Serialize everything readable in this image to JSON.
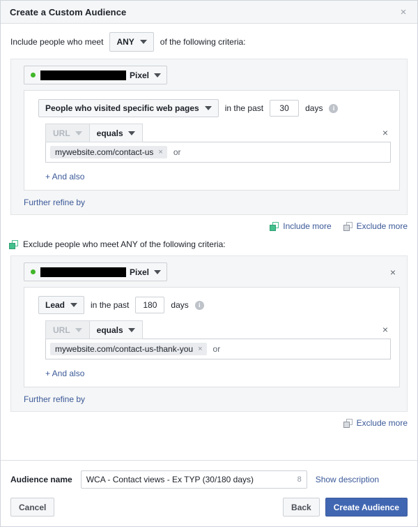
{
  "dialog": {
    "title": "Create a Custom Audience",
    "close_icon": "×"
  },
  "include": {
    "prefix_text": "Include people who meet",
    "match_operator": "ANY",
    "suffix_text": "of the following criteria:",
    "pixel": {
      "name_redacted": "",
      "label": "Pixel",
      "status": "active"
    },
    "rule": {
      "event": "People who visited specific web pages",
      "in_the_past": "in the past",
      "days_value": "30",
      "days_label": "days",
      "info_icon": "i",
      "field": "URL",
      "comparator": "equals",
      "values": [
        {
          "text": "mywebsite.com/contact-us",
          "remove_icon": "×"
        }
      ],
      "or_label": "or",
      "remove_icon": "×"
    },
    "and_also": "+ And also",
    "further_refine": "Further refine by"
  },
  "more_actions": {
    "include_more": "Include more",
    "exclude_more": "Exclude more"
  },
  "exclude": {
    "header_text": "Exclude people who meet ANY of the following criteria:",
    "pixel": {
      "name_redacted": "",
      "label": "Pixel",
      "status": "active",
      "remove_icon": "×"
    },
    "rule": {
      "event": "Lead",
      "in_the_past": "in the past",
      "days_value": "180",
      "days_label": "days",
      "info_icon": "i",
      "field": "URL",
      "comparator": "equals",
      "values": [
        {
          "text": "mywebsite.com/contact-us-thank-you",
          "remove_icon": "×"
        }
      ],
      "or_label": "or",
      "remove_icon": "×"
    },
    "and_also": "+ And also",
    "further_refine": "Further refine by",
    "exclude_more": "Exclude more"
  },
  "footer": {
    "audience_name_label": "Audience name",
    "audience_name_value": "WCA - Contact views - Ex TYP (30/180 days)",
    "audience_name_placeholder": "Audience name",
    "char_count": "8",
    "show_description": "Show description",
    "cancel_label": "Cancel",
    "back_label": "Back",
    "create_label": "Create Audience"
  },
  "colors": {
    "primary": "#4267b2",
    "link": "#3b5998",
    "status_dot": "#42b72a",
    "include_icon": "#44c08c"
  }
}
